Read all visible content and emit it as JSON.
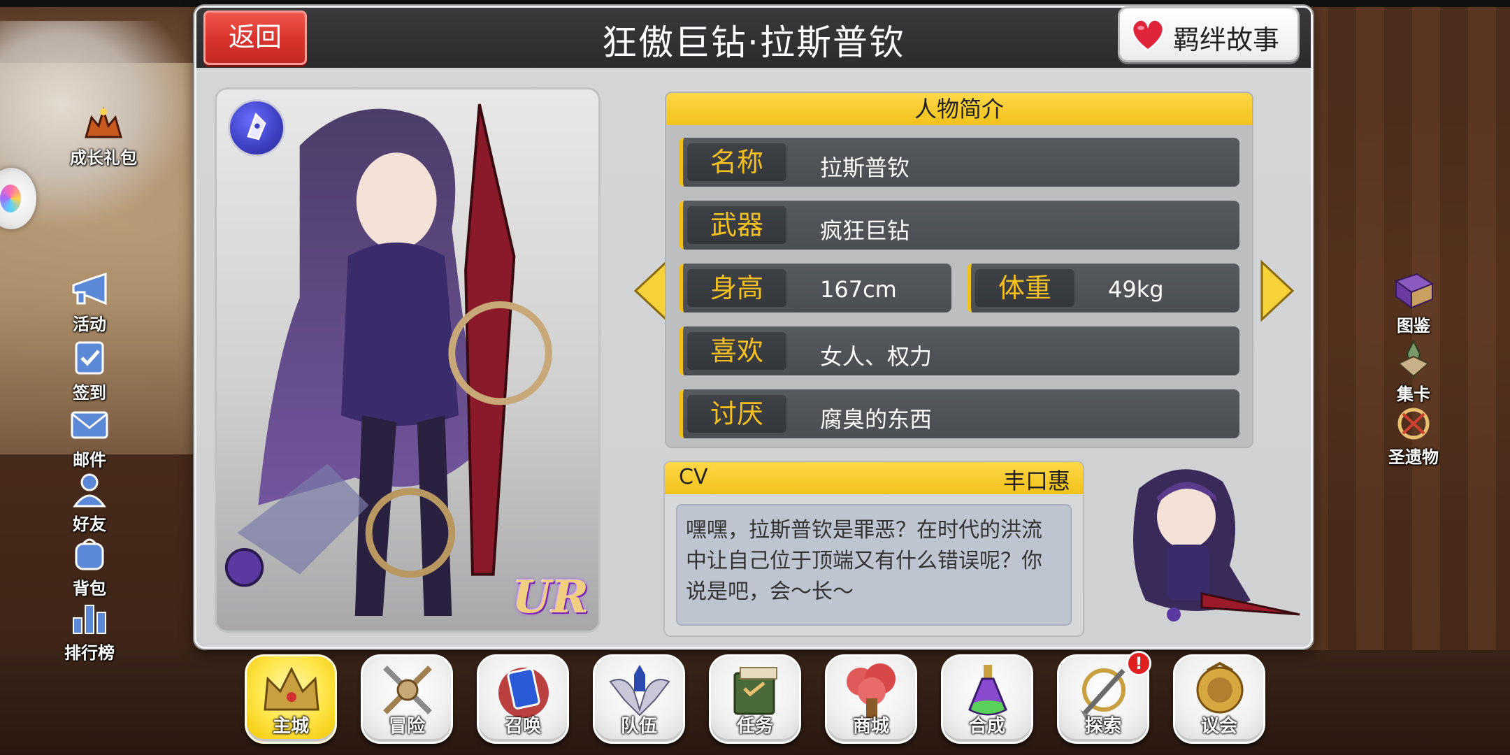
{
  "header": {
    "back_label": "返回",
    "title": "狂傲巨钻·拉斯普钦",
    "bond_label": "羁绊故事"
  },
  "left_menu": [
    {
      "label": "成长礼包",
      "icon": "growth-gift-icon"
    },
    {
      "label": "活动",
      "icon": "megaphone-icon"
    },
    {
      "label": "签到",
      "icon": "checkin-clipboard-icon"
    },
    {
      "label": "邮件",
      "icon": "mail-icon"
    },
    {
      "label": "好友",
      "icon": "friends-icon"
    },
    {
      "label": "背包",
      "icon": "backpack-icon"
    },
    {
      "label": "排行榜",
      "icon": "ranking-bars-icon"
    }
  ],
  "right_menu": [
    {
      "label": "图鉴",
      "icon": "codex-book-icon"
    },
    {
      "label": "集卡",
      "icon": "card-collect-icon"
    },
    {
      "label": "圣遗物",
      "icon": "relic-icon"
    }
  ],
  "portrait": {
    "rarity": "UR",
    "class_icon": "pen-nib-icon"
  },
  "profile": {
    "heading": "人物简介",
    "name": {
      "key": "名称",
      "value": "拉斯普钦"
    },
    "weapon": {
      "key": "武器",
      "value": "疯狂巨钻"
    },
    "height": {
      "key": "身高",
      "value": "167cm"
    },
    "weight": {
      "key": "体重",
      "value": "49kg"
    },
    "likes": {
      "key": "喜欢",
      "value": "女人、权力"
    },
    "dislikes": {
      "key": "讨厌",
      "value": "腐臭的东西"
    }
  },
  "cv": {
    "label": "CV",
    "name": "丰口惠",
    "line": "嘿嘿，拉斯普钦是罪恶？在时代的洪流中让自己位于顶端又有什么错误呢？你说是吧，会～长～"
  },
  "bottom_nav": [
    {
      "label": "主城",
      "icon": "crown-icon",
      "active": true
    },
    {
      "label": "冒险",
      "icon": "crossed-swords-icon"
    },
    {
      "label": "召唤",
      "icon": "summon-card-icon"
    },
    {
      "label": "队伍",
      "icon": "winged-emblem-icon"
    },
    {
      "label": "任务",
      "icon": "quest-book-icon"
    },
    {
      "label": "商城",
      "icon": "shop-tree-icon"
    },
    {
      "label": "合成",
      "icon": "potion-flask-icon"
    },
    {
      "label": "探索",
      "icon": "compass-shovel-icon",
      "badge": "!"
    },
    {
      "label": "议会",
      "icon": "council-seal-icon"
    }
  ],
  "colors": {
    "accent_yellow": "#f2c21a",
    "back_red": "#d8332c",
    "panel_grey": "#d4d6d8",
    "row_dark": "#4a4d51",
    "key_gold": "#f5c020"
  }
}
